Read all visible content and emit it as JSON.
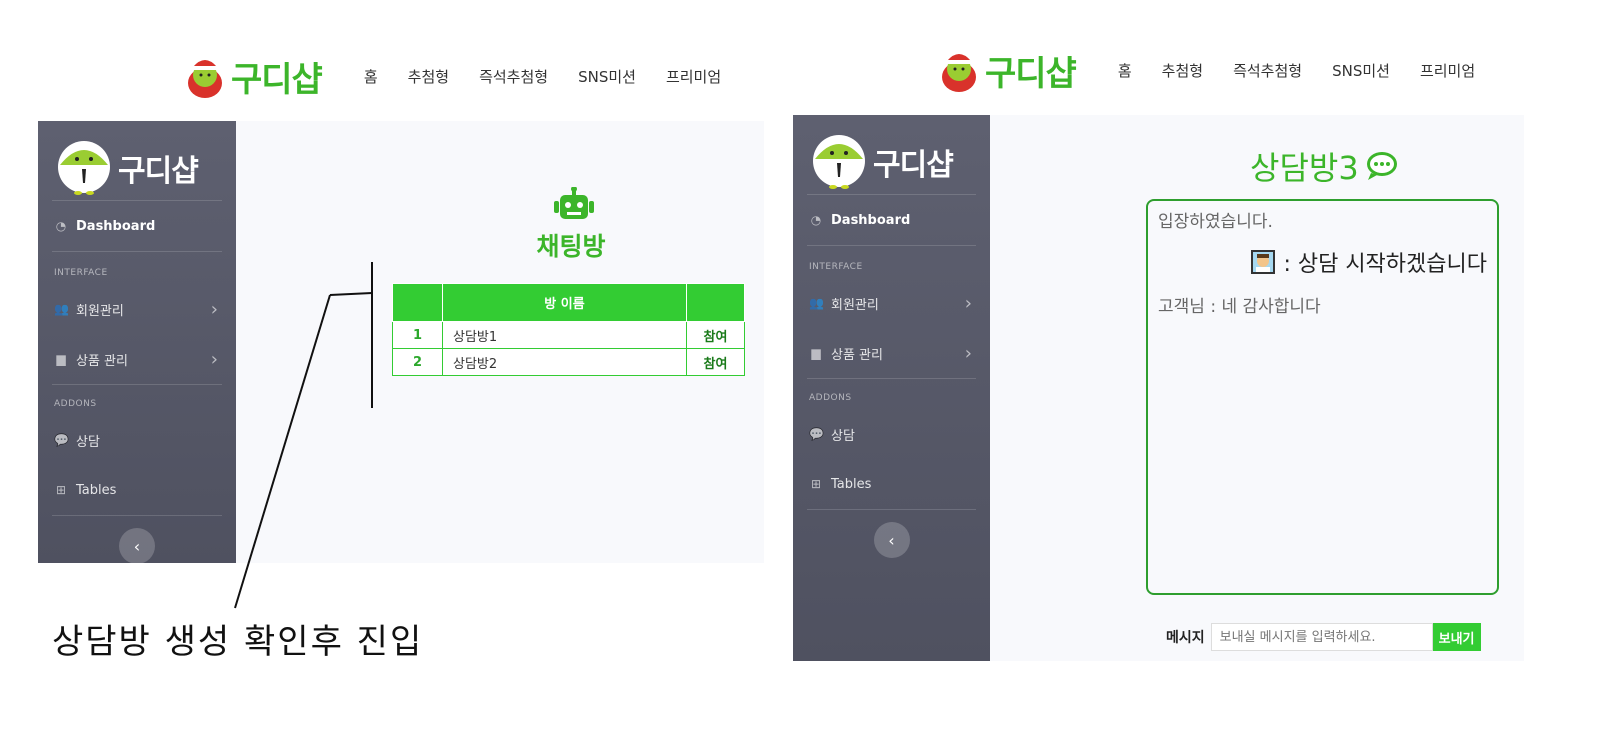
{
  "left": {
    "nav": {
      "logo": "구디샵",
      "items": [
        "홈",
        "추첨형",
        "즉석추첨형",
        "SNS미션",
        "프리미엄"
      ]
    },
    "sidebar": {
      "brand": "구디샵",
      "dashboard": "Dashboard",
      "heading_interface": "INTERFACE",
      "member": "회원관리",
      "product": "상품 관리",
      "heading_addons": "ADDONS",
      "consult": "상담",
      "tables": "Tables",
      "toggle": "‹"
    },
    "main": {
      "title": "채팅방",
      "table": {
        "header": [
          "",
          "방 이름",
          ""
        ],
        "rows": [
          {
            "no": "1",
            "name": "상담방1",
            "action": "참여"
          },
          {
            "no": "2",
            "name": "상담방2",
            "action": "참여"
          }
        ]
      }
    }
  },
  "annotation": "상담방 생성 확인후 진입",
  "right": {
    "nav": {
      "logo": "구디샵",
      "items": [
        "홈",
        "추첨형",
        "즉석추첨형",
        "SNS미션",
        "프리미엄"
      ]
    },
    "sidebar": {
      "brand": "구디샵",
      "dashboard": "Dashboard",
      "heading_interface": "INTERFACE",
      "member": "회원관리",
      "product": "상품 관리",
      "heading_addons": "ADDONS",
      "consult": "상담",
      "tables": "Tables",
      "toggle": "‹"
    },
    "main": {
      "title": "상담방3",
      "messages": {
        "system": "입장하였습니다.",
        "me": ": 상담 시작하겠습니다",
        "customer": "고객님 : 네 감사합니다"
      },
      "compose": {
        "label": "메시지",
        "placeholder": "보내실 메시지를 입력하세요.",
        "send": "보내기"
      }
    }
  },
  "colors": {
    "brand_green": "#3cb52a",
    "table_green": "#33cc33",
    "sidebar": "#5a5c6a"
  }
}
